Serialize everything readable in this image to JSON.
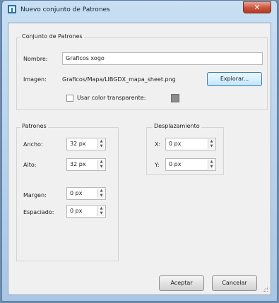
{
  "window": {
    "title": "Nuevo conjunto de Patrones",
    "close_symbol": "✕"
  },
  "tileset": {
    "group_title": "Conjunto de Patrones",
    "name_label": "Nombre:",
    "name_value": "Graficos xogo",
    "image_label": "Imagen:",
    "image_path": "Graficos/Mapa/LIBGDX_mapa_sheet.png",
    "browse_label": "Explorar...",
    "transparent_label": "Usar color transparente:",
    "transparent_checked": false,
    "transparent_color": "#8c8c8c"
  },
  "tiles": {
    "group_title": "Patrones",
    "width_label": "Ancho:",
    "width_value": "32 px",
    "height_label": "Alto:",
    "height_value": "32 px",
    "margin_label": "Margen:",
    "margin_value": "0 px",
    "spacing_label": "Espaciado:",
    "spacing_value": "0 px"
  },
  "offset": {
    "group_title": "Desplazamiento",
    "x_label": "X:",
    "x_value": "0 px",
    "y_label": "Y:",
    "y_value": "0 px"
  },
  "buttons": {
    "ok_label": "Aceptar",
    "cancel_label": "Cancelar"
  },
  "icons": {
    "app": "tiled-app-icon",
    "close": "close-icon",
    "spin_up": "spin-up-icon",
    "spin_down": "spin-down-icon",
    "grip": "resize-grip-icon"
  }
}
